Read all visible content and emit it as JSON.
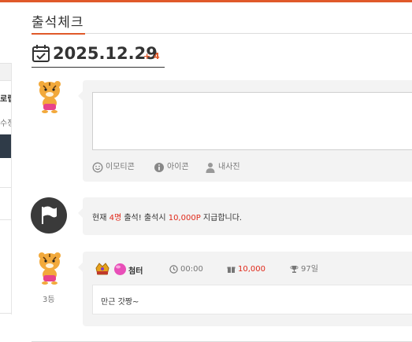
{
  "header": {
    "title": "출석체크",
    "date": "2025.12.29",
    "date_delta": "+ 4"
  },
  "sidebar_fragment": {
    "item_text": "로랩",
    "sub_text": "수정"
  },
  "comment_form": {
    "tools": [
      {
        "icon": "smile-icon",
        "label": "이모티콘"
      },
      {
        "icon": "info-icon",
        "label": "아이콘"
      },
      {
        "icon": "person-icon",
        "label": "내사진"
      }
    ]
  },
  "notice": {
    "prefix": "현재 ",
    "count": "4명",
    "middle": " 출석! 출석시 ",
    "points": "10,000P",
    "suffix": " 지급합니다."
  },
  "entry": {
    "rank": "3등",
    "nickname": "첨터",
    "time": "00:00",
    "points": "10,000",
    "days": "97일",
    "message": "만근 갓짱~"
  },
  "colors": {
    "accent": "#e0592a",
    "highlight": "#e0291a",
    "panel": "#f3f3f3"
  }
}
